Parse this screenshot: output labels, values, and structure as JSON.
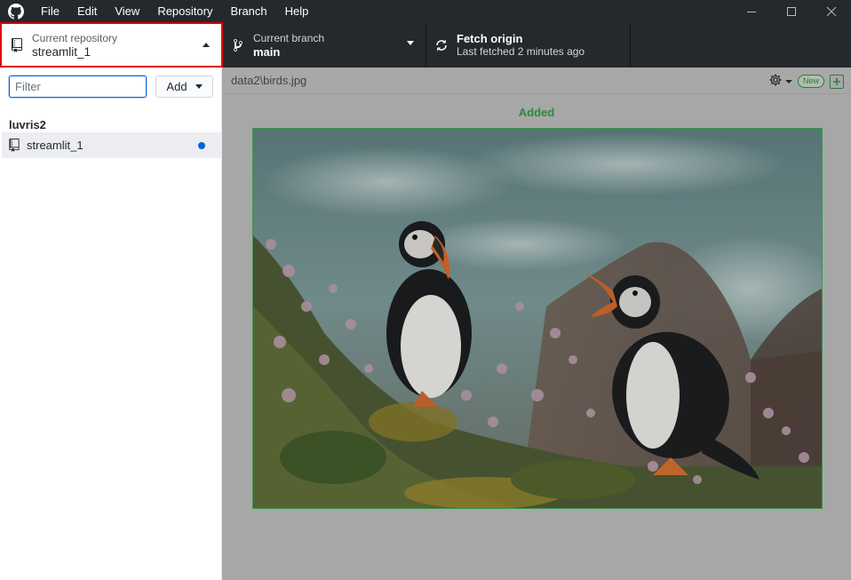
{
  "titlebar": {
    "menu": [
      "File",
      "Edit",
      "View",
      "Repository",
      "Branch",
      "Help"
    ]
  },
  "toolbar": {
    "repo_caption": "Current repository",
    "repo_name": "streamlit_1",
    "branch_caption": "Current branch",
    "branch_name": "main",
    "fetch_title": "Fetch origin",
    "fetch_subtitle": "Last fetched 2 minutes ago"
  },
  "sidebar": {
    "filter_placeholder": "Filter",
    "add_label": "Add",
    "group": "luvris2",
    "repos": [
      {
        "name": "streamlit_1",
        "has_changes": true
      }
    ]
  },
  "diff": {
    "path": "data2\\birds.jpg",
    "new_badge": "New",
    "status_label": "Added"
  },
  "colors": {
    "accent": "#0366d6",
    "added": "#2a8a3a",
    "highlight_border": "#e00000",
    "toolbar_bg": "#24292e"
  }
}
